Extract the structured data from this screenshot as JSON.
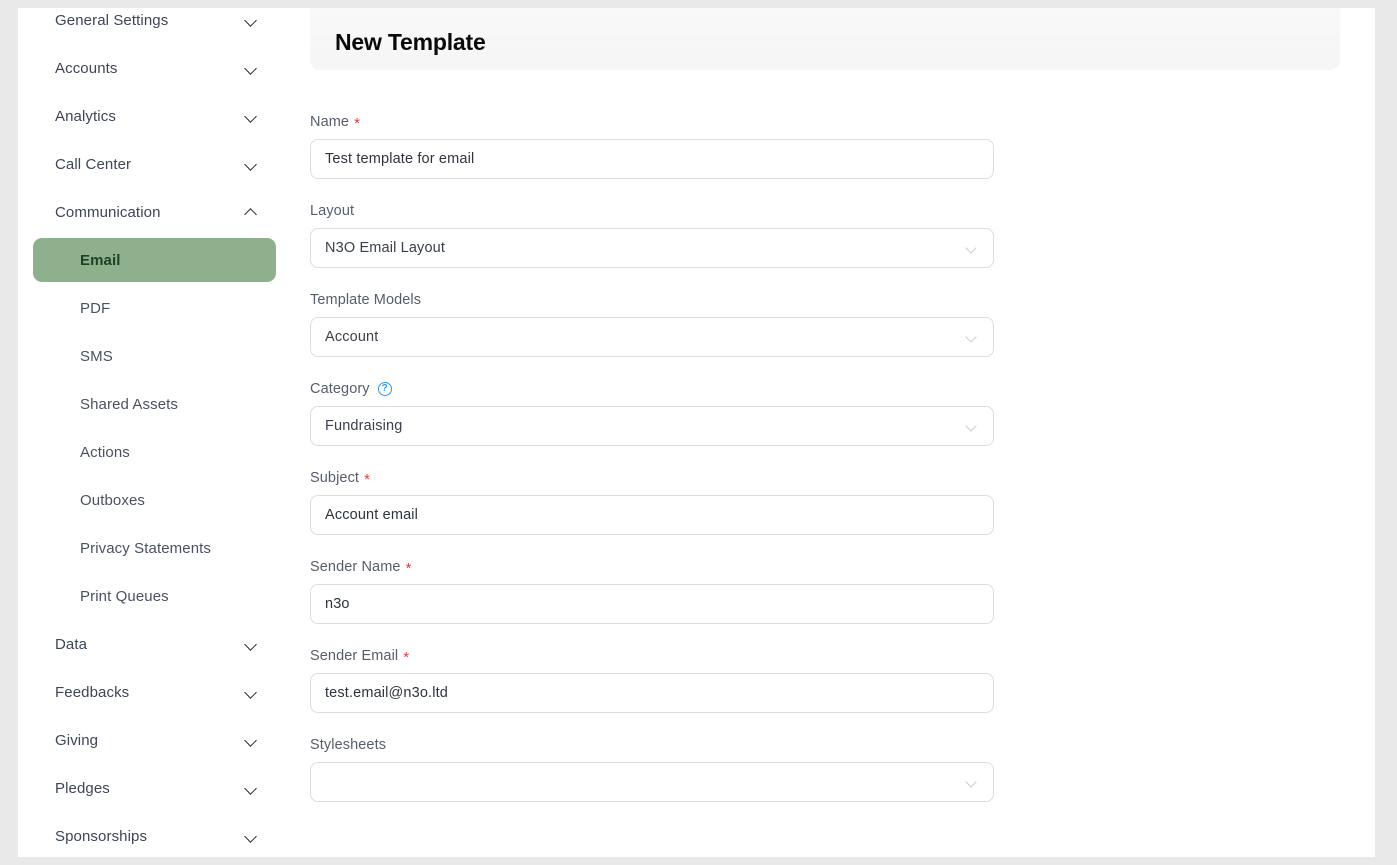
{
  "header": {
    "title": "New Template"
  },
  "sidebar": {
    "items": [
      {
        "label": "General Settings",
        "type": "group",
        "icon": "chevron-down-icon",
        "expanded": false
      },
      {
        "label": "Accounts",
        "type": "group",
        "icon": "chevron-down-icon",
        "expanded": false
      },
      {
        "label": "Analytics",
        "type": "group",
        "icon": "chevron-down-icon",
        "expanded": false
      },
      {
        "label": "Call Center",
        "type": "group",
        "icon": "chevron-down-icon",
        "expanded": false
      },
      {
        "label": "Communication",
        "type": "group",
        "icon": "chevron-up-icon",
        "expanded": true
      },
      {
        "label": "Email",
        "type": "sub",
        "active": true
      },
      {
        "label": "PDF",
        "type": "sub",
        "active": false
      },
      {
        "label": "SMS",
        "type": "sub",
        "active": false
      },
      {
        "label": "Shared Assets",
        "type": "sub",
        "active": false
      },
      {
        "label": "Actions",
        "type": "sub",
        "active": false
      },
      {
        "label": "Outboxes",
        "type": "sub",
        "active": false
      },
      {
        "label": "Privacy Statements",
        "type": "sub",
        "active": false
      },
      {
        "label": "Print Queues",
        "type": "sub",
        "active": false
      },
      {
        "label": "Data",
        "type": "group",
        "icon": "chevron-down-icon",
        "expanded": false
      },
      {
        "label": "Feedbacks",
        "type": "group",
        "icon": "chevron-down-icon",
        "expanded": false
      },
      {
        "label": "Giving",
        "type": "group",
        "icon": "chevron-down-icon",
        "expanded": false
      },
      {
        "label": "Pledges",
        "type": "group",
        "icon": "chevron-down-icon",
        "expanded": false
      },
      {
        "label": "Sponsorships",
        "type": "group",
        "icon": "chevron-down-icon",
        "expanded": false
      }
    ],
    "active_item": "Email"
  },
  "form": {
    "fields": [
      {
        "label": "Name",
        "required": true,
        "help": false,
        "kind": "text",
        "value": "Test template for email",
        "placeholder": ""
      },
      {
        "label": "Layout",
        "required": false,
        "help": false,
        "kind": "select",
        "value": "N3O Email Layout",
        "placeholder": ""
      },
      {
        "label": "Template Models",
        "required": false,
        "help": false,
        "kind": "select",
        "value": "Account",
        "placeholder": ""
      },
      {
        "label": "Category",
        "required": false,
        "help": true,
        "kind": "select",
        "value": "Fundraising",
        "placeholder": ""
      },
      {
        "label": "Subject",
        "required": true,
        "help": false,
        "kind": "text",
        "value": "Account email",
        "placeholder": ""
      },
      {
        "label": "Sender Name",
        "required": true,
        "help": false,
        "kind": "text",
        "value": "n3o",
        "placeholder": ""
      },
      {
        "label": "Sender Email",
        "required": true,
        "help": false,
        "kind": "text",
        "value": "test.email@n3o.ltd",
        "placeholder": ""
      },
      {
        "label": "Stylesheets",
        "required": false,
        "help": false,
        "kind": "select",
        "value": "",
        "placeholder": ""
      }
    ],
    "required_marker": "*",
    "help_glyph": "?"
  },
  "colors": {
    "accent_active": "#8fb08d",
    "accent_active_text": "#1f4227",
    "required": "#e23b3b",
    "help_icon": "#3498e8",
    "page_bg": "#e9e9e9",
    "panel_bg": "#ffffff",
    "header_bg": "#f7f7f8",
    "input_border": "#dcdde1",
    "label_text": "#565d6b",
    "nav_text": "#3e4555"
  }
}
